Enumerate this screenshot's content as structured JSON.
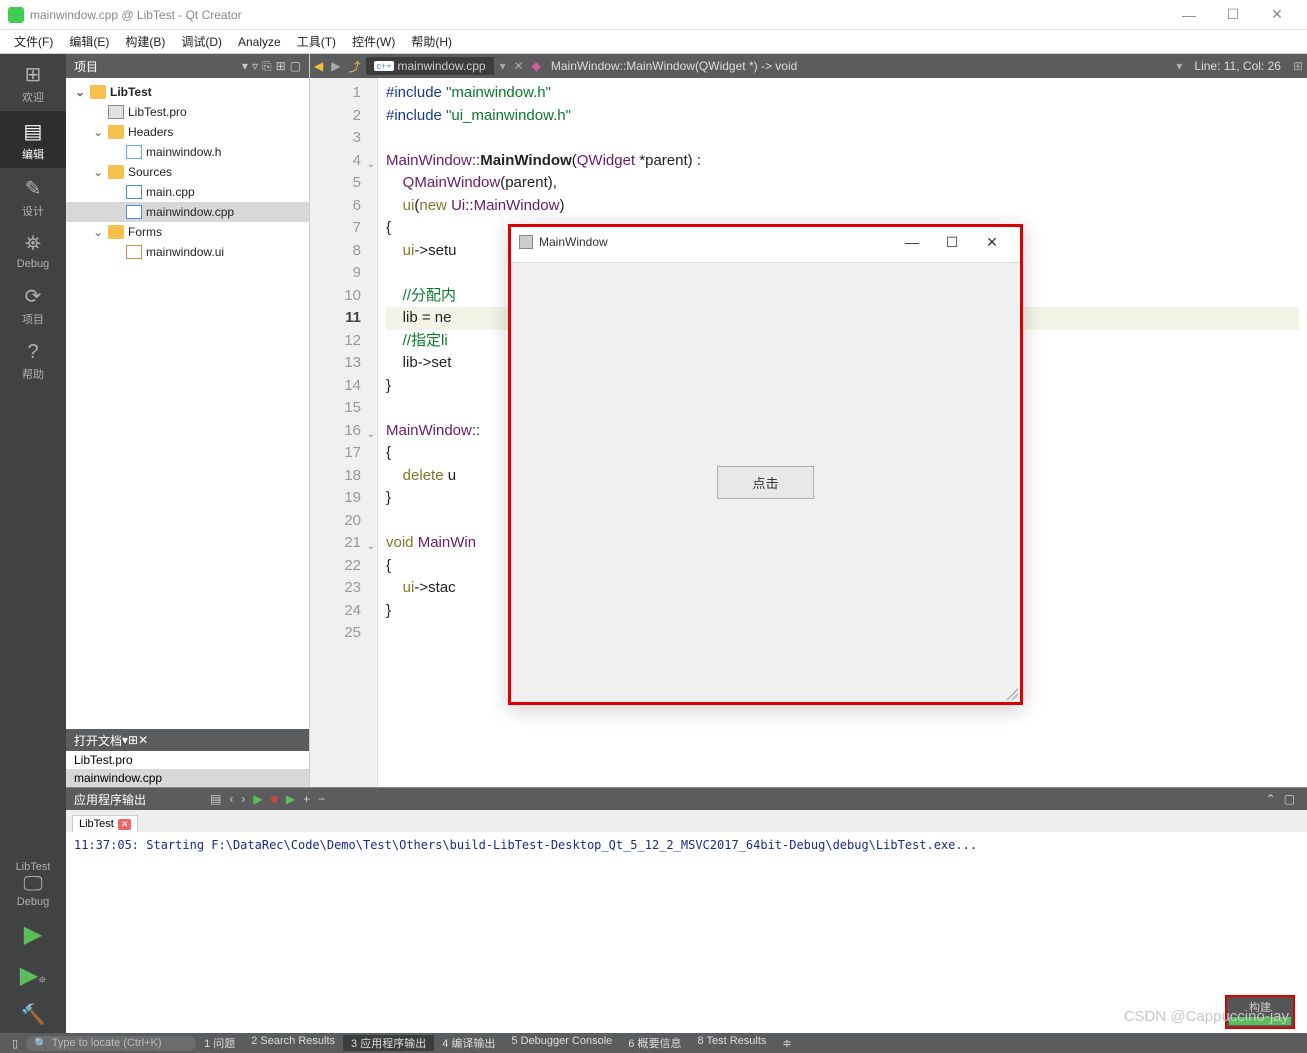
{
  "window": {
    "title": "mainwindow.cpp @ LibTest - Qt Creator",
    "controls": {
      "min": "—",
      "max": "☐",
      "close": "✕"
    }
  },
  "menubar": [
    "文件(F)",
    "编辑(E)",
    "构建(B)",
    "调试(D)",
    "Analyze",
    "工具(T)",
    "控件(W)",
    "帮助(H)"
  ],
  "leftbar": {
    "items": [
      {
        "icon": "⊞",
        "label": "欢迎"
      },
      {
        "icon": "▤",
        "label": "编辑"
      },
      {
        "icon": "✎",
        "label": "设计"
      },
      {
        "icon": "⛯",
        "label": "Debug"
      },
      {
        "icon": "⟳",
        "label": "项目"
      },
      {
        "icon": "?",
        "label": "帮助"
      }
    ],
    "bottom": {
      "project": "LibTest",
      "monitor": "🖵",
      "debug": "Debug"
    }
  },
  "project_header": {
    "label": "项目"
  },
  "tree": [
    {
      "indent": 0,
      "tw": "⌄",
      "icon": "folder",
      "label": "LibTest",
      "bold": true
    },
    {
      "indent": 1,
      "tw": "",
      "icon": "file-pro",
      "label": "LibTest.pro"
    },
    {
      "indent": 1,
      "tw": "⌄",
      "icon": "folder",
      "label": "Headers"
    },
    {
      "indent": 2,
      "tw": "",
      "icon": "file-h",
      "label": "mainwindow.h"
    },
    {
      "indent": 1,
      "tw": "⌄",
      "icon": "folder",
      "label": "Sources"
    },
    {
      "indent": 2,
      "tw": "",
      "icon": "file-cpp",
      "label": "main.cpp"
    },
    {
      "indent": 2,
      "tw": "",
      "icon": "file-cpp",
      "label": "mainwindow.cpp",
      "sel": true
    },
    {
      "indent": 1,
      "tw": "⌄",
      "icon": "folder",
      "label": "Forms"
    },
    {
      "indent": 2,
      "tw": "",
      "icon": "file-ui",
      "label": "mainwindow.ui"
    }
  ],
  "open_docs": {
    "header": "打开文档",
    "items": [
      "LibTest.pro",
      "mainwindow.cpp"
    ],
    "selected": 1
  },
  "editor": {
    "file": "mainwindow.cpp",
    "crumb": "MainWindow::MainWindow(QWidget *) -> void",
    "pos": "Line: 11, Col: 26",
    "current_line": 11,
    "folds": [
      4,
      16,
      21
    ],
    "lines": [
      "<span class='pp'>#include</span> <span class='str'>\"mainwindow.h\"</span>",
      "<span class='pp'>#include</span> <span class='str'>\"ui_mainwindow.h\"</span>",
      "",
      "<span class='type'>MainWindow</span>::<span class='func'>MainWindow</span>(<span class='type'>QWidget</span> *parent) :",
      "    <span class='type'>QMainWindow</span>(parent),",
      "    <span class='kw'>ui</span>(<span class='kw'>new</span> <span class='type'>Ui</span>::<span class='type'>MainWindow</span>)",
      "{",
      "    <span class='kw'>ui</span>-&gt;setu",
      "",
      "    <span class='comment'>//分配内</span>",
      "    lib = ne",
      "    <span class='comment'>//指定li                                                       get的第二页</span>",
      "    lib-&gt;set",
      "}",
      "",
      "<span class='type'>MainWindow</span>::",
      "{",
      "    <span class='kw'>delete</span> u",
      "}",
      "",
      "<span class='kw'>void</span> <span class='type'>MainWin</span>",
      "{",
      "    <span class='kw'>ui</span>-&gt;stac",
      "}",
      ""
    ]
  },
  "output": {
    "title": "应用程序输出",
    "tab": "LibTest",
    "text": "11:37:05: Starting F:\\DataRec\\Code\\Demo\\Test\\Others\\build-LibTest-Desktop_Qt_5_12_2_MSVC2017_64bit-Debug\\debug\\LibTest.exe..."
  },
  "statusbar": {
    "locator_placeholder": "Type to locate (Ctrl+K)",
    "items": [
      "1 问题",
      "2 Search Results",
      "3 应用程序输出",
      "4 编译输出",
      "5 Debugger Console",
      "6 概要信息",
      "8 Test Results"
    ],
    "active": 2
  },
  "popup": {
    "title": "MainWindow",
    "button": "点击",
    "controls": {
      "min": "—",
      "max": "☐",
      "close": "✕"
    }
  },
  "build_badge": "构建",
  "watermark": "CSDN @Cappuccino-jay"
}
